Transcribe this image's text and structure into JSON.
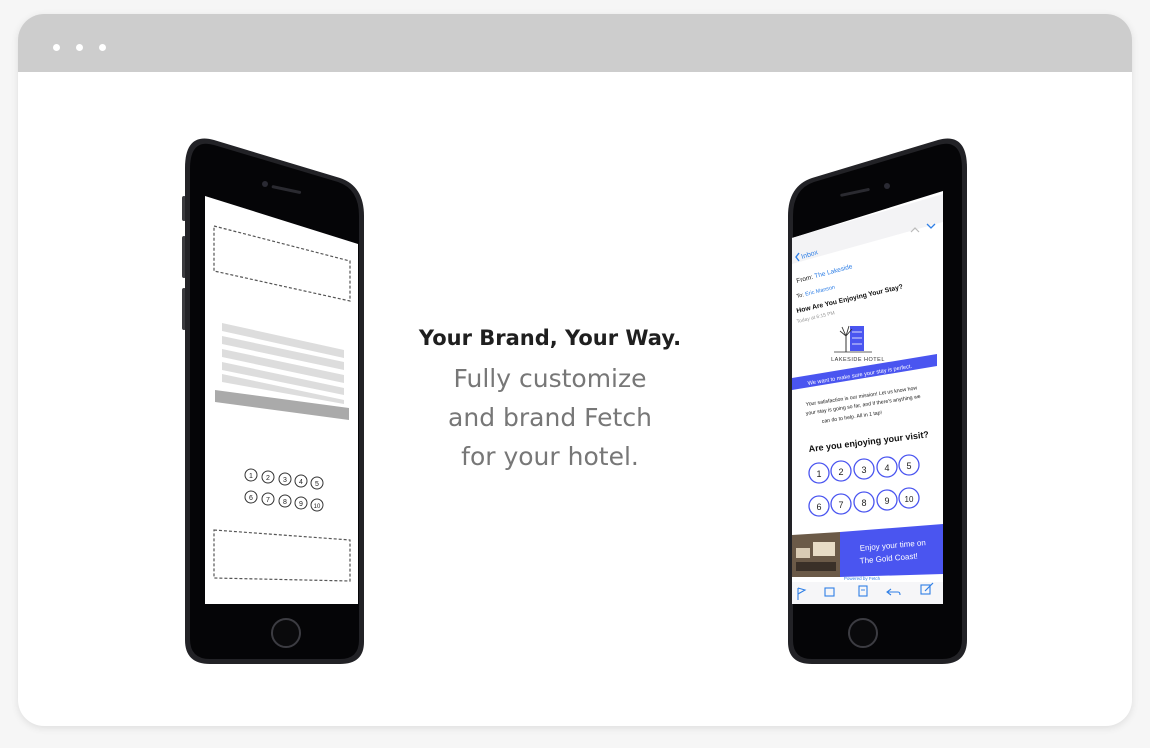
{
  "hero": {
    "headline": "Your Brand, Your Way.",
    "sub_lines": [
      "Fully customize",
      "and brand Fetch",
      "for your hotel."
    ]
  },
  "wireframe_phone": {
    "rating_numbers": [
      "1",
      "2",
      "3",
      "4",
      "5",
      "6",
      "7",
      "8",
      "9",
      "10"
    ]
  },
  "email_phone": {
    "inbox_label": "Inbox",
    "from_label": "From:",
    "from_value": "The Lakeside",
    "to_label": "To:",
    "to_value": "Eric Manson",
    "subject": "How Are You Enjoying Your Stay?",
    "time": "Today at 6:15 PM",
    "hotel_name": "LAKESIDE HOTEL",
    "banner_text": "We want to make sure your stay is perfect.",
    "body_line1": "Your satisfaction is our mission! Let us know how",
    "body_line2": "your stay is going so far, and if there's anything we",
    "body_line3": "can do to help. All in 1 tap!",
    "question": "Are you enjoying your visit?",
    "rating_numbers": [
      "1",
      "2",
      "3",
      "4",
      "5",
      "6",
      "7",
      "8",
      "9",
      "10"
    ],
    "promo_line1": "Enjoy your time on",
    "promo_line2": "The Gold Coast!",
    "powered_by": "Powered by Fetch",
    "accent_color": "#4a55f0",
    "link_color": "#2f7fe6"
  }
}
